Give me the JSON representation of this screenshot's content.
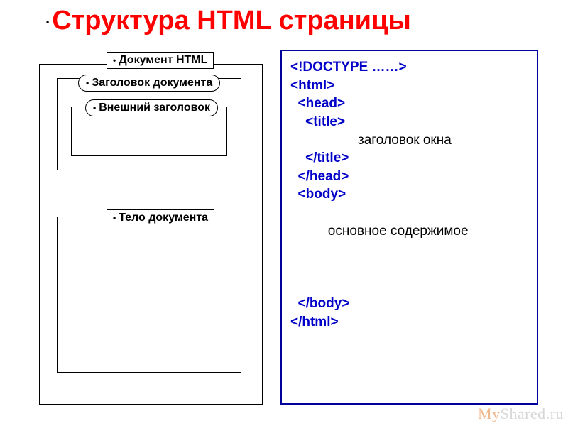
{
  "title": "Структура HTML страницы",
  "diagram": {
    "doc": "Документ HTML",
    "head": "Заголовок документа",
    "title_inner": "Внешний заголовок",
    "body": "Тело документа"
  },
  "code": {
    "l0": "<!DOCTYPE ……>",
    "l1": "<html>",
    "l2": "  <head>",
    "l3": "    <title>",
    "l4_text": "                  заголовок окна",
    "l5": "    </title>",
    "l6": "  </head>",
    "l7": "  <body>",
    "l8_blank": " ",
    "l9_text": "          основное содержимое",
    "l13": "  </body>",
    "l14": "</html>"
  },
  "watermark": {
    "left": "My",
    "right": "Shared.ru"
  }
}
